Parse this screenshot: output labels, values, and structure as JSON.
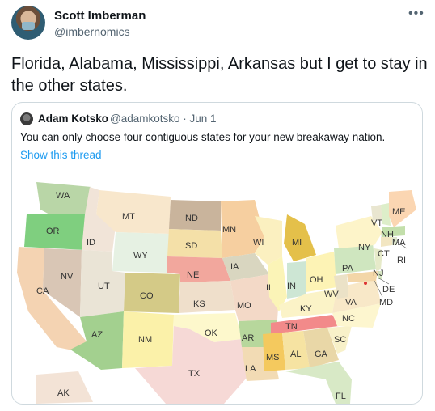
{
  "tweet": {
    "author_name": "Scott Imberman",
    "author_handle": "@imbernomics",
    "more_icon": "more-icon",
    "text": "Florida, Alabama, Mississippi, Arkansas but I get to stay in the other states."
  },
  "quote": {
    "author_name": "Adam Kotsko",
    "author_handle": "@adamkotsko · Jun 1",
    "text": "You can only choose four contiguous states for your new breakaway nation.",
    "show_thread": "Show this thread"
  },
  "map": {
    "labels": {
      "WA": "WA",
      "OR": "OR",
      "CA": "CA",
      "ID": "ID",
      "NV": "NV",
      "MT": "MT",
      "WY": "WY",
      "UT": "UT",
      "AZ": "AZ",
      "CO": "CO",
      "NM": "NM",
      "ND": "ND",
      "SD": "SD",
      "NE": "NE",
      "KS": "KS",
      "OK": "OK",
      "TX": "TX",
      "MN": "MN",
      "IA": "IA",
      "MO": "MO",
      "AR": "AR",
      "LA": "LA",
      "WI": "WI",
      "IL": "IL",
      "MI": "MI",
      "IN": "IN",
      "OH": "OH",
      "KY": "KY",
      "TN": "TN",
      "MS": "MS",
      "AL": "AL",
      "GA": "GA",
      "FL": "FL",
      "SC": "SC",
      "NC": "NC",
      "VA": "VA",
      "WV": "WV",
      "PA": "PA",
      "NY": "NY",
      "VT": "VT",
      "NH": "NH",
      "ME": "ME",
      "MA": "MA",
      "RI": "RI",
      "CT": "CT",
      "NJ": "NJ",
      "DE": "DE",
      "MD": "MD",
      "AK": "AK"
    }
  }
}
